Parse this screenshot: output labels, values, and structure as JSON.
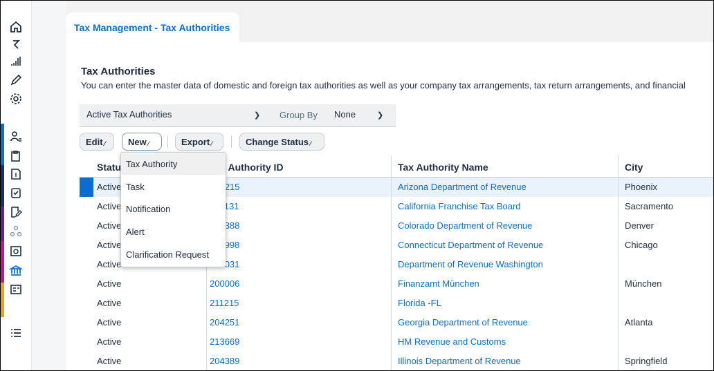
{
  "app": {
    "tab_title": "Tax Management - Tax Authorities",
    "page_title": "Tax Authorities",
    "description": "You can enter the master data of domestic and foreign tax authorities as well as your company tax arrangements, tax return arrangements, and financial"
  },
  "rail": {
    "icons": [
      "home-icon",
      "activity-icon",
      "chart-icon",
      "edit-icon",
      "settings-icon",
      "person-list-icon",
      "clipboard-dollar-icon",
      "document-dollar-icon",
      "clipboard-check-icon",
      "document-edit-icon",
      "org-icon",
      "calendar-search-icon",
      "bank-icon",
      "report-icon",
      "list-icon"
    ]
  },
  "filters": {
    "selected_view": "Active Tax Authorities",
    "group_by_label": "Group By",
    "group_by_value": "None"
  },
  "toolbar": {
    "edit": "Edit",
    "new": "New",
    "export": "Export",
    "change_status": "Change Status"
  },
  "new_menu": {
    "items": [
      "Tax Authority",
      "Task",
      "Notification",
      "Alert",
      "Clarification Request"
    ]
  },
  "table": {
    "headers": {
      "status": "Status",
      "id": "Tax Authority ID",
      "name": "Tax Authority Name",
      "city": "City"
    },
    "rows": [
      {
        "status": "Active",
        "id": "215215",
        "name": "Arizona Department of Revenue",
        "city": "Phoenix"
      },
      {
        "status": "Active",
        "id": "131131",
        "name": "California Franchise Tax Board",
        "city": "Sacramento"
      },
      {
        "status": "Active",
        "id": "388388",
        "name": "Colorado Department of Revenue",
        "city": "Denver"
      },
      {
        "status": "Active",
        "id": "298998",
        "name": "Connecticut Department of Revenue",
        "city": "Chicago"
      },
      {
        "status": "Active",
        "id": "207031",
        "name": "Department of Revenue Washington",
        "city": ""
      },
      {
        "status": "Active",
        "id": "200006",
        "name": "Finanzamt München",
        "city": "München"
      },
      {
        "status": "Active",
        "id": "211215",
        "name": "Florida -FL",
        "city": ""
      },
      {
        "status": "Active",
        "id": "204251",
        "name": "Georgia Department of Revenue",
        "city": "Atlanta"
      },
      {
        "status": "Active",
        "id": "213669",
        "name": "HM Revenue and Customs",
        "city": ""
      },
      {
        "status": "Active",
        "id": "204389",
        "name": "Illinois Department of Revenue",
        "city": "Springfield"
      }
    ]
  },
  "colors": {
    "accent": "#0a6ed1",
    "text": "#1d2d3e"
  }
}
